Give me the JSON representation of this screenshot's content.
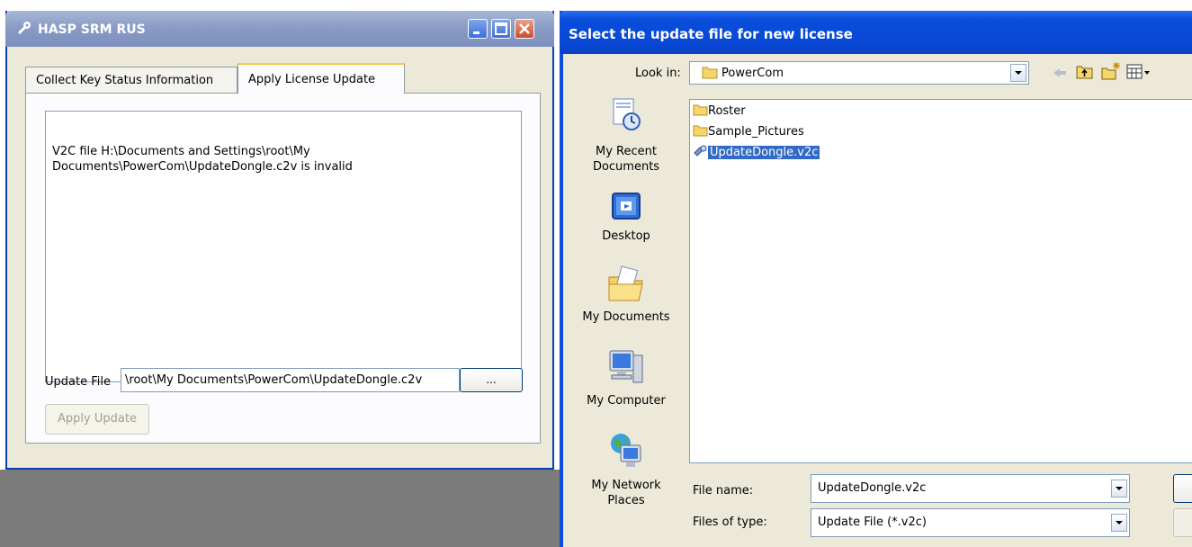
{
  "left_window": {
    "title": "HASP SRM RUS",
    "icon": "hasp-key-icon",
    "tabs": [
      {
        "label": "Collect Key Status Information",
        "active": false
      },
      {
        "label": "Apply License Update",
        "active": true
      }
    ],
    "status_message": "V2C file H:\\Documents and Settings\\root\\My\nDocuments\\PowerCom\\UpdateDongle.c2v is invalid",
    "update_file": {
      "label": "Update File",
      "value": "\\root\\My Documents\\PowerCom\\UpdateDongle.c2v",
      "browse_label": "..."
    },
    "apply_button": "Apply Update"
  },
  "dialog": {
    "title": "Select the update file for new license",
    "look_in": {
      "label": "Look in:",
      "value": "PowerCom",
      "icon": "folder-icon"
    },
    "toolbar_icons": [
      "back-arrow-icon",
      "up-folder-icon",
      "new-folder-icon",
      "view-menu-icon"
    ],
    "places": [
      {
        "label": "My Recent\nDocuments",
        "icon": "recent-documents-icon"
      },
      {
        "label": "Desktop",
        "icon": "desktop-icon"
      },
      {
        "label": "My Documents",
        "icon": "my-documents-icon"
      },
      {
        "label": "My Computer",
        "icon": "my-computer-icon"
      },
      {
        "label": "My Network\nPlaces",
        "icon": "network-places-icon"
      }
    ],
    "files": [
      {
        "name": "Roster",
        "type": "folder",
        "selected": false
      },
      {
        "name": "Sample_Pictures",
        "type": "folder",
        "selected": false
      },
      {
        "name": "UpdateDongle.v2c",
        "type": "v2c",
        "selected": true
      }
    ],
    "file_name": {
      "label": "File name:",
      "value": "UpdateDongle.v2c"
    },
    "file_type": {
      "label": "Files of type:",
      "value": "Update File (*.v2c)"
    }
  },
  "colors": {
    "xp_blue": "#0a4edb",
    "inactive_title": "#8a9cc6",
    "selection": "#316ac5",
    "dialog_face": "#ece9d8"
  }
}
